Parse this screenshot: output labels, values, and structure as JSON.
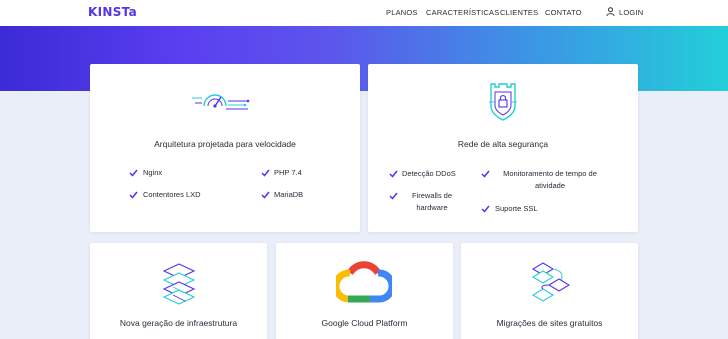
{
  "nav": {
    "logo": "KINSTa",
    "links": [
      "PLANOS",
      "CARACTERÍSTICAS",
      "CLIENTES",
      "CONTATO"
    ],
    "login": "LOGIN"
  },
  "cards": {
    "speed": {
      "title": "Arquitetura projetada para velocidade",
      "features": [
        "Nginx",
        "PHP 7.4",
        "Contentores LXD",
        "MariaDB"
      ]
    },
    "security": {
      "title": "Rede de alta segurança",
      "features": [
        "Detecção DDoS",
        "Monitoramento de tempo de atividade",
        "Firewalls de hardware",
        "Suporte SSL"
      ]
    },
    "infra": {
      "title": "Nova geração de infraestrutura"
    },
    "gcp": {
      "title": "Google Cloud Platform"
    },
    "migrations": {
      "title": "Migrações de sites gratuitos"
    }
  },
  "colors": {
    "brand": "#5333ed",
    "teal": "#22cfd9",
    "check": "#5333ed",
    "page_bg": "#e9eef8"
  },
  "icons": [
    "user-icon",
    "check-icon",
    "speedometer-icon",
    "shield-icon",
    "stack-layers-icon",
    "google-cloud-logo",
    "migration-layers-icon"
  ]
}
